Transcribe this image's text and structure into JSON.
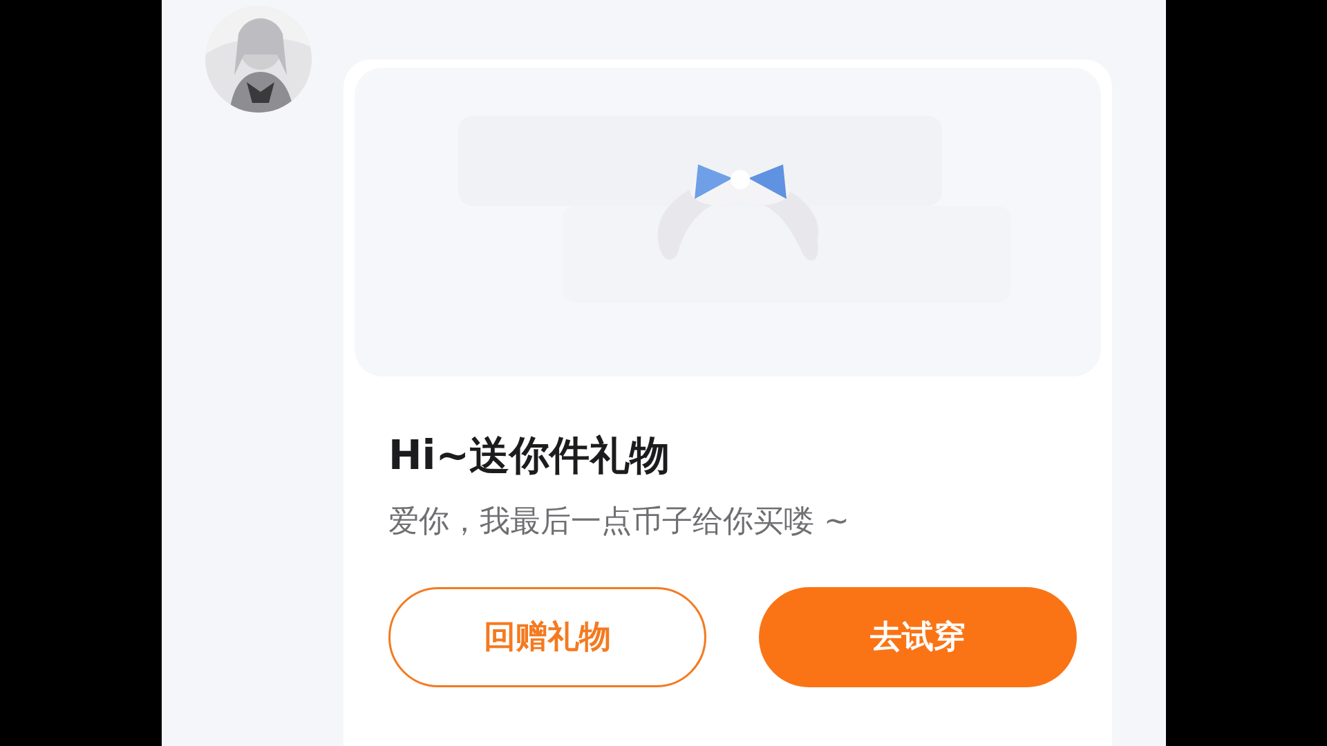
{
  "gift_card": {
    "title": "Hi~送你件礼物",
    "message": "爱你，我最后一点币子给你买喽 ~",
    "buttons": [
      {
        "label": "回赠礼物",
        "kind": "outline"
      },
      {
        "label": "去试穿",
        "kind": "filled"
      }
    ]
  }
}
